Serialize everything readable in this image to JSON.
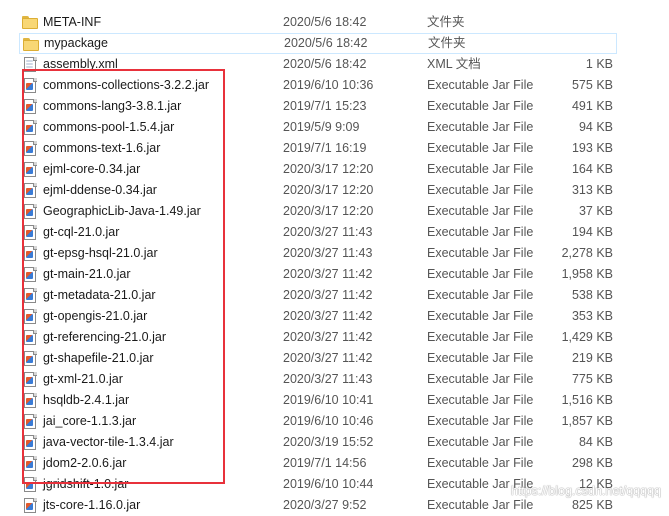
{
  "files": [
    {
      "name": "META-INF",
      "date": "2020/5/6 18:42",
      "type": "文件夹",
      "size": "",
      "kind": "folder"
    },
    {
      "name": "mypackage",
      "date": "2020/5/6 18:42",
      "type": "文件夹",
      "size": "",
      "kind": "folder"
    },
    {
      "name": "assembly.xml",
      "date": "2020/5/6 18:42",
      "type": "XML 文档",
      "size": "1 KB",
      "kind": "xml"
    },
    {
      "name": "commons-collections-3.2.2.jar",
      "date": "2019/6/10 10:36",
      "type": "Executable Jar File",
      "size": "575 KB",
      "kind": "jar"
    },
    {
      "name": "commons-lang3-3.8.1.jar",
      "date": "2019/7/1 15:23",
      "type": "Executable Jar File",
      "size": "491 KB",
      "kind": "jar"
    },
    {
      "name": "commons-pool-1.5.4.jar",
      "date": "2019/5/9 9:09",
      "type": "Executable Jar File",
      "size": "94 KB",
      "kind": "jar"
    },
    {
      "name": "commons-text-1.6.jar",
      "date": "2019/7/1 16:19",
      "type": "Executable Jar File",
      "size": "193 KB",
      "kind": "jar"
    },
    {
      "name": "ejml-core-0.34.jar",
      "date": "2020/3/17 12:20",
      "type": "Executable Jar File",
      "size": "164 KB",
      "kind": "jar"
    },
    {
      "name": "ejml-ddense-0.34.jar",
      "date": "2020/3/17 12:20",
      "type": "Executable Jar File",
      "size": "313 KB",
      "kind": "jar"
    },
    {
      "name": "GeographicLib-Java-1.49.jar",
      "date": "2020/3/17 12:20",
      "type": "Executable Jar File",
      "size": "37 KB",
      "kind": "jar"
    },
    {
      "name": "gt-cql-21.0.jar",
      "date": "2020/3/27 11:43",
      "type": "Executable Jar File",
      "size": "194 KB",
      "kind": "jar"
    },
    {
      "name": "gt-epsg-hsql-21.0.jar",
      "date": "2020/3/27 11:43",
      "type": "Executable Jar File",
      "size": "2,278 KB",
      "kind": "jar"
    },
    {
      "name": "gt-main-21.0.jar",
      "date": "2020/3/27 11:42",
      "type": "Executable Jar File",
      "size": "1,958 KB",
      "kind": "jar"
    },
    {
      "name": "gt-metadata-21.0.jar",
      "date": "2020/3/27 11:42",
      "type": "Executable Jar File",
      "size": "538 KB",
      "kind": "jar"
    },
    {
      "name": "gt-opengis-21.0.jar",
      "date": "2020/3/27 11:42",
      "type": "Executable Jar File",
      "size": "353 KB",
      "kind": "jar"
    },
    {
      "name": "gt-referencing-21.0.jar",
      "date": "2020/3/27 11:42",
      "type": "Executable Jar File",
      "size": "1,429 KB",
      "kind": "jar"
    },
    {
      "name": "gt-shapefile-21.0.jar",
      "date": "2020/3/27 11:42",
      "type": "Executable Jar File",
      "size": "219 KB",
      "kind": "jar"
    },
    {
      "name": "gt-xml-21.0.jar",
      "date": "2020/3/27 11:43",
      "type": "Executable Jar File",
      "size": "775 KB",
      "kind": "jar"
    },
    {
      "name": "hsqldb-2.4.1.jar",
      "date": "2019/6/10 10:41",
      "type": "Executable Jar File",
      "size": "1,516 KB",
      "kind": "jar"
    },
    {
      "name": "jai_core-1.1.3.jar",
      "date": "2019/6/10 10:46",
      "type": "Executable Jar File",
      "size": "1,857 KB",
      "kind": "jar"
    },
    {
      "name": "java-vector-tile-1.3.4.jar",
      "date": "2020/3/19 15:52",
      "type": "Executable Jar File",
      "size": "84 KB",
      "kind": "jar"
    },
    {
      "name": "jdom2-2.0.6.jar",
      "date": "2019/7/1 14:56",
      "type": "Executable Jar File",
      "size": "298 KB",
      "kind": "jar"
    },
    {
      "name": "jgridshift-1.0.jar",
      "date": "2019/6/10 10:44",
      "type": "Executable Jar File",
      "size": "12 KB",
      "kind": "jar"
    },
    {
      "name": "jts-core-1.16.0.jar",
      "date": "2020/3/27 9:52",
      "type": "Executable Jar File",
      "size": "825 KB",
      "kind": "jar"
    }
  ],
  "hover_index": 1,
  "watermark": "https://blog.csdn.net/qqqqq",
  "colors": {
    "highlight": "#e8313b",
    "hover_border": "#cce8ff",
    "folder": "#f8d775"
  }
}
